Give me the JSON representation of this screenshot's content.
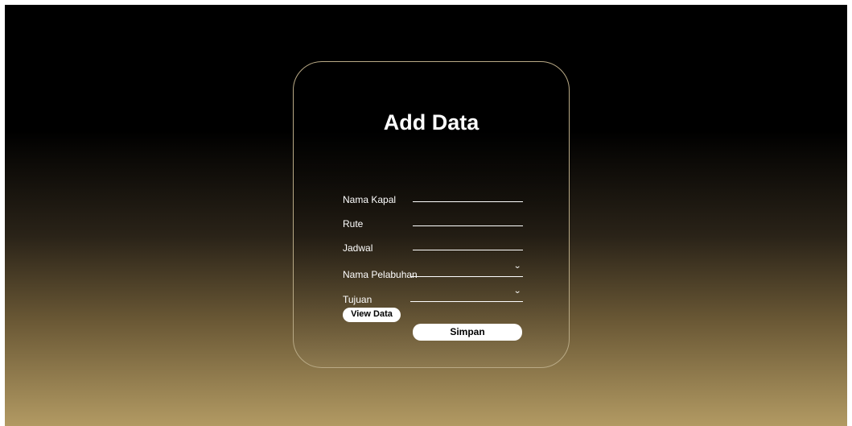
{
  "form": {
    "title": "Add Data",
    "fields": [
      {
        "label": "Nama Kapal",
        "value": "",
        "type": "text"
      },
      {
        "label": "Rute",
        "value": "",
        "type": "text"
      },
      {
        "label": "Jadwal",
        "value": "",
        "type": "text"
      },
      {
        "label": "Nama Pelabuhan",
        "value": "",
        "type": "select",
        "icon": "chevron-down-icon"
      },
      {
        "label": "Tujuan",
        "value": "",
        "type": "select",
        "icon": "chevron-down-icon"
      }
    ],
    "view_button_label": "View Data",
    "save_button_label": "Simpan",
    "chevron_glyph": "⌄"
  },
  "colors": {
    "background_top": "#000000",
    "background_bottom": "#b29a63",
    "card_border": "#b9aa86",
    "text": "#ffffff",
    "button_bg": "#ffffff",
    "button_text": "#000000"
  }
}
